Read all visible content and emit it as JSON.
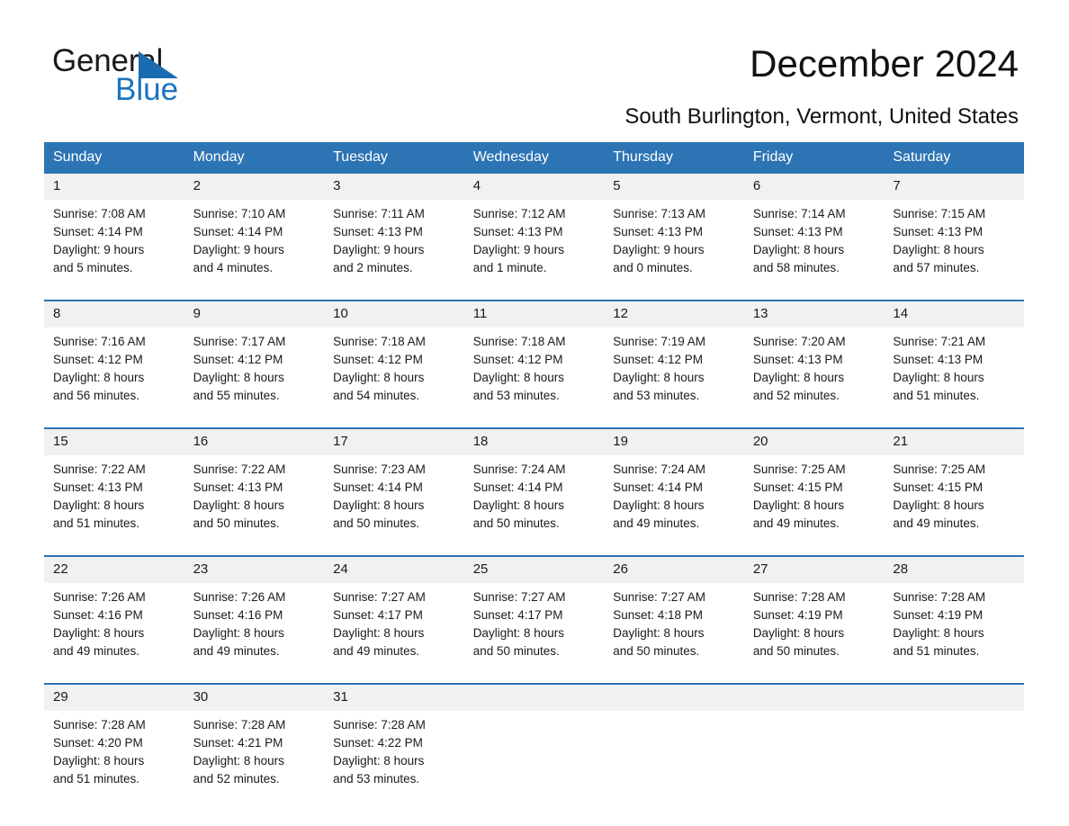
{
  "brand": {
    "name_part1": "General",
    "name_part2": "Blue",
    "accent_color": "#2d74b4"
  },
  "header": {
    "title": "December 2024",
    "location": "South Burlington, Vermont, United States"
  },
  "calendar": {
    "weekday_headers": [
      "Sunday",
      "Monday",
      "Tuesday",
      "Wednesday",
      "Thursday",
      "Friday",
      "Saturday"
    ],
    "labels": {
      "sunrise_prefix": "Sunrise:",
      "sunset_prefix": "Sunset:",
      "daylight_prefix": "Daylight:"
    },
    "weeks": [
      [
        {
          "date": "1",
          "sunrise": "Sunrise: 7:08 AM",
          "sunset": "Sunset: 4:14 PM",
          "daylight_line1": "Daylight: 9 hours",
          "daylight_line2": "and 5 minutes."
        },
        {
          "date": "2",
          "sunrise": "Sunrise: 7:10 AM",
          "sunset": "Sunset: 4:14 PM",
          "daylight_line1": "Daylight: 9 hours",
          "daylight_line2": "and 4 minutes."
        },
        {
          "date": "3",
          "sunrise": "Sunrise: 7:11 AM",
          "sunset": "Sunset: 4:13 PM",
          "daylight_line1": "Daylight: 9 hours",
          "daylight_line2": "and 2 minutes."
        },
        {
          "date": "4",
          "sunrise": "Sunrise: 7:12 AM",
          "sunset": "Sunset: 4:13 PM",
          "daylight_line1": "Daylight: 9 hours",
          "daylight_line2": "and 1 minute."
        },
        {
          "date": "5",
          "sunrise": "Sunrise: 7:13 AM",
          "sunset": "Sunset: 4:13 PM",
          "daylight_line1": "Daylight: 9 hours",
          "daylight_line2": "and 0 minutes."
        },
        {
          "date": "6",
          "sunrise": "Sunrise: 7:14 AM",
          "sunset": "Sunset: 4:13 PM",
          "daylight_line1": "Daylight: 8 hours",
          "daylight_line2": "and 58 minutes."
        },
        {
          "date": "7",
          "sunrise": "Sunrise: 7:15 AM",
          "sunset": "Sunset: 4:13 PM",
          "daylight_line1": "Daylight: 8 hours",
          "daylight_line2": "and 57 minutes."
        }
      ],
      [
        {
          "date": "8",
          "sunrise": "Sunrise: 7:16 AM",
          "sunset": "Sunset: 4:12 PM",
          "daylight_line1": "Daylight: 8 hours",
          "daylight_line2": "and 56 minutes."
        },
        {
          "date": "9",
          "sunrise": "Sunrise: 7:17 AM",
          "sunset": "Sunset: 4:12 PM",
          "daylight_line1": "Daylight: 8 hours",
          "daylight_line2": "and 55 minutes."
        },
        {
          "date": "10",
          "sunrise": "Sunrise: 7:18 AM",
          "sunset": "Sunset: 4:12 PM",
          "daylight_line1": "Daylight: 8 hours",
          "daylight_line2": "and 54 minutes."
        },
        {
          "date": "11",
          "sunrise": "Sunrise: 7:18 AM",
          "sunset": "Sunset: 4:12 PM",
          "daylight_line1": "Daylight: 8 hours",
          "daylight_line2": "and 53 minutes."
        },
        {
          "date": "12",
          "sunrise": "Sunrise: 7:19 AM",
          "sunset": "Sunset: 4:12 PM",
          "daylight_line1": "Daylight: 8 hours",
          "daylight_line2": "and 53 minutes."
        },
        {
          "date": "13",
          "sunrise": "Sunrise: 7:20 AM",
          "sunset": "Sunset: 4:13 PM",
          "daylight_line1": "Daylight: 8 hours",
          "daylight_line2": "and 52 minutes."
        },
        {
          "date": "14",
          "sunrise": "Sunrise: 7:21 AM",
          "sunset": "Sunset: 4:13 PM",
          "daylight_line1": "Daylight: 8 hours",
          "daylight_line2": "and 51 minutes."
        }
      ],
      [
        {
          "date": "15",
          "sunrise": "Sunrise: 7:22 AM",
          "sunset": "Sunset: 4:13 PM",
          "daylight_line1": "Daylight: 8 hours",
          "daylight_line2": "and 51 minutes."
        },
        {
          "date": "16",
          "sunrise": "Sunrise: 7:22 AM",
          "sunset": "Sunset: 4:13 PM",
          "daylight_line1": "Daylight: 8 hours",
          "daylight_line2": "and 50 minutes."
        },
        {
          "date": "17",
          "sunrise": "Sunrise: 7:23 AM",
          "sunset": "Sunset: 4:14 PM",
          "daylight_line1": "Daylight: 8 hours",
          "daylight_line2": "and 50 minutes."
        },
        {
          "date": "18",
          "sunrise": "Sunrise: 7:24 AM",
          "sunset": "Sunset: 4:14 PM",
          "daylight_line1": "Daylight: 8 hours",
          "daylight_line2": "and 50 minutes."
        },
        {
          "date": "19",
          "sunrise": "Sunrise: 7:24 AM",
          "sunset": "Sunset: 4:14 PM",
          "daylight_line1": "Daylight: 8 hours",
          "daylight_line2": "and 49 minutes."
        },
        {
          "date": "20",
          "sunrise": "Sunrise: 7:25 AM",
          "sunset": "Sunset: 4:15 PM",
          "daylight_line1": "Daylight: 8 hours",
          "daylight_line2": "and 49 minutes."
        },
        {
          "date": "21",
          "sunrise": "Sunrise: 7:25 AM",
          "sunset": "Sunset: 4:15 PM",
          "daylight_line1": "Daylight: 8 hours",
          "daylight_line2": "and 49 minutes."
        }
      ],
      [
        {
          "date": "22",
          "sunrise": "Sunrise: 7:26 AM",
          "sunset": "Sunset: 4:16 PM",
          "daylight_line1": "Daylight: 8 hours",
          "daylight_line2": "and 49 minutes."
        },
        {
          "date": "23",
          "sunrise": "Sunrise: 7:26 AM",
          "sunset": "Sunset: 4:16 PM",
          "daylight_line1": "Daylight: 8 hours",
          "daylight_line2": "and 49 minutes."
        },
        {
          "date": "24",
          "sunrise": "Sunrise: 7:27 AM",
          "sunset": "Sunset: 4:17 PM",
          "daylight_line1": "Daylight: 8 hours",
          "daylight_line2": "and 49 minutes."
        },
        {
          "date": "25",
          "sunrise": "Sunrise: 7:27 AM",
          "sunset": "Sunset: 4:17 PM",
          "daylight_line1": "Daylight: 8 hours",
          "daylight_line2": "and 50 minutes."
        },
        {
          "date": "26",
          "sunrise": "Sunrise: 7:27 AM",
          "sunset": "Sunset: 4:18 PM",
          "daylight_line1": "Daylight: 8 hours",
          "daylight_line2": "and 50 minutes."
        },
        {
          "date": "27",
          "sunrise": "Sunrise: 7:28 AM",
          "sunset": "Sunset: 4:19 PM",
          "daylight_line1": "Daylight: 8 hours",
          "daylight_line2": "and 50 minutes."
        },
        {
          "date": "28",
          "sunrise": "Sunrise: 7:28 AM",
          "sunset": "Sunset: 4:19 PM",
          "daylight_line1": "Daylight: 8 hours",
          "daylight_line2": "and 51 minutes."
        }
      ],
      [
        {
          "date": "29",
          "sunrise": "Sunrise: 7:28 AM",
          "sunset": "Sunset: 4:20 PM",
          "daylight_line1": "Daylight: 8 hours",
          "daylight_line2": "and 51 minutes."
        },
        {
          "date": "30",
          "sunrise": "Sunrise: 7:28 AM",
          "sunset": "Sunset: 4:21 PM",
          "daylight_line1": "Daylight: 8 hours",
          "daylight_line2": "and 52 minutes."
        },
        {
          "date": "31",
          "sunrise": "Sunrise: 7:28 AM",
          "sunset": "Sunset: 4:22 PM",
          "daylight_line1": "Daylight: 8 hours",
          "daylight_line2": "and 53 minutes."
        },
        {
          "date": "",
          "sunrise": "",
          "sunset": "",
          "daylight_line1": "",
          "daylight_line2": ""
        },
        {
          "date": "",
          "sunrise": "",
          "sunset": "",
          "daylight_line1": "",
          "daylight_line2": ""
        },
        {
          "date": "",
          "sunrise": "",
          "sunset": "",
          "daylight_line1": "",
          "daylight_line2": ""
        },
        {
          "date": "",
          "sunrise": "",
          "sunset": "",
          "daylight_line1": "",
          "daylight_line2": ""
        }
      ]
    ]
  }
}
